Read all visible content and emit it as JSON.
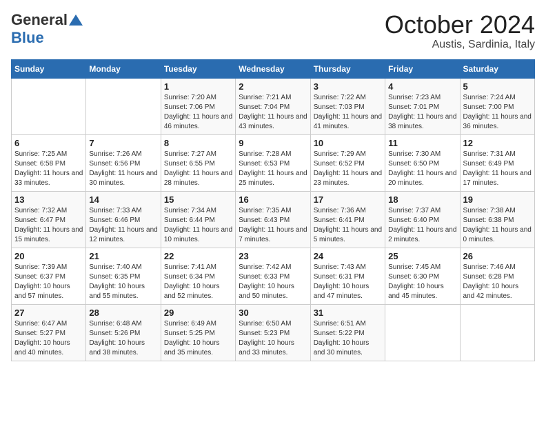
{
  "logo": {
    "general": "General",
    "blue": "Blue"
  },
  "title": {
    "month": "October 2024",
    "location": "Austis, Sardinia, Italy"
  },
  "headers": [
    "Sunday",
    "Monday",
    "Tuesday",
    "Wednesday",
    "Thursday",
    "Friday",
    "Saturday"
  ],
  "weeks": [
    [
      {
        "day": "",
        "info": ""
      },
      {
        "day": "",
        "info": ""
      },
      {
        "day": "1",
        "info": "Sunrise: 7:20 AM\nSunset: 7:06 PM\nDaylight: 11 hours and 46 minutes."
      },
      {
        "day": "2",
        "info": "Sunrise: 7:21 AM\nSunset: 7:04 PM\nDaylight: 11 hours and 43 minutes."
      },
      {
        "day": "3",
        "info": "Sunrise: 7:22 AM\nSunset: 7:03 PM\nDaylight: 11 hours and 41 minutes."
      },
      {
        "day": "4",
        "info": "Sunrise: 7:23 AM\nSunset: 7:01 PM\nDaylight: 11 hours and 38 minutes."
      },
      {
        "day": "5",
        "info": "Sunrise: 7:24 AM\nSunset: 7:00 PM\nDaylight: 11 hours and 36 minutes."
      }
    ],
    [
      {
        "day": "6",
        "info": "Sunrise: 7:25 AM\nSunset: 6:58 PM\nDaylight: 11 hours and 33 minutes."
      },
      {
        "day": "7",
        "info": "Sunrise: 7:26 AM\nSunset: 6:56 PM\nDaylight: 11 hours and 30 minutes."
      },
      {
        "day": "8",
        "info": "Sunrise: 7:27 AM\nSunset: 6:55 PM\nDaylight: 11 hours and 28 minutes."
      },
      {
        "day": "9",
        "info": "Sunrise: 7:28 AM\nSunset: 6:53 PM\nDaylight: 11 hours and 25 minutes."
      },
      {
        "day": "10",
        "info": "Sunrise: 7:29 AM\nSunset: 6:52 PM\nDaylight: 11 hours and 23 minutes."
      },
      {
        "day": "11",
        "info": "Sunrise: 7:30 AM\nSunset: 6:50 PM\nDaylight: 11 hours and 20 minutes."
      },
      {
        "day": "12",
        "info": "Sunrise: 7:31 AM\nSunset: 6:49 PM\nDaylight: 11 hours and 17 minutes."
      }
    ],
    [
      {
        "day": "13",
        "info": "Sunrise: 7:32 AM\nSunset: 6:47 PM\nDaylight: 11 hours and 15 minutes."
      },
      {
        "day": "14",
        "info": "Sunrise: 7:33 AM\nSunset: 6:46 PM\nDaylight: 11 hours and 12 minutes."
      },
      {
        "day": "15",
        "info": "Sunrise: 7:34 AM\nSunset: 6:44 PM\nDaylight: 11 hours and 10 minutes."
      },
      {
        "day": "16",
        "info": "Sunrise: 7:35 AM\nSunset: 6:43 PM\nDaylight: 11 hours and 7 minutes."
      },
      {
        "day": "17",
        "info": "Sunrise: 7:36 AM\nSunset: 6:41 PM\nDaylight: 11 hours and 5 minutes."
      },
      {
        "day": "18",
        "info": "Sunrise: 7:37 AM\nSunset: 6:40 PM\nDaylight: 11 hours and 2 minutes."
      },
      {
        "day": "19",
        "info": "Sunrise: 7:38 AM\nSunset: 6:38 PM\nDaylight: 11 hours and 0 minutes."
      }
    ],
    [
      {
        "day": "20",
        "info": "Sunrise: 7:39 AM\nSunset: 6:37 PM\nDaylight: 10 hours and 57 minutes."
      },
      {
        "day": "21",
        "info": "Sunrise: 7:40 AM\nSunset: 6:35 PM\nDaylight: 10 hours and 55 minutes."
      },
      {
        "day": "22",
        "info": "Sunrise: 7:41 AM\nSunset: 6:34 PM\nDaylight: 10 hours and 52 minutes."
      },
      {
        "day": "23",
        "info": "Sunrise: 7:42 AM\nSunset: 6:33 PM\nDaylight: 10 hours and 50 minutes."
      },
      {
        "day": "24",
        "info": "Sunrise: 7:43 AM\nSunset: 6:31 PM\nDaylight: 10 hours and 47 minutes."
      },
      {
        "day": "25",
        "info": "Sunrise: 7:45 AM\nSunset: 6:30 PM\nDaylight: 10 hours and 45 minutes."
      },
      {
        "day": "26",
        "info": "Sunrise: 7:46 AM\nSunset: 6:28 PM\nDaylight: 10 hours and 42 minutes."
      }
    ],
    [
      {
        "day": "27",
        "info": "Sunrise: 6:47 AM\nSunset: 5:27 PM\nDaylight: 10 hours and 40 minutes."
      },
      {
        "day": "28",
        "info": "Sunrise: 6:48 AM\nSunset: 5:26 PM\nDaylight: 10 hours and 38 minutes."
      },
      {
        "day": "29",
        "info": "Sunrise: 6:49 AM\nSunset: 5:25 PM\nDaylight: 10 hours and 35 minutes."
      },
      {
        "day": "30",
        "info": "Sunrise: 6:50 AM\nSunset: 5:23 PM\nDaylight: 10 hours and 33 minutes."
      },
      {
        "day": "31",
        "info": "Sunrise: 6:51 AM\nSunset: 5:22 PM\nDaylight: 10 hours and 30 minutes."
      },
      {
        "day": "",
        "info": ""
      },
      {
        "day": "",
        "info": ""
      }
    ]
  ]
}
